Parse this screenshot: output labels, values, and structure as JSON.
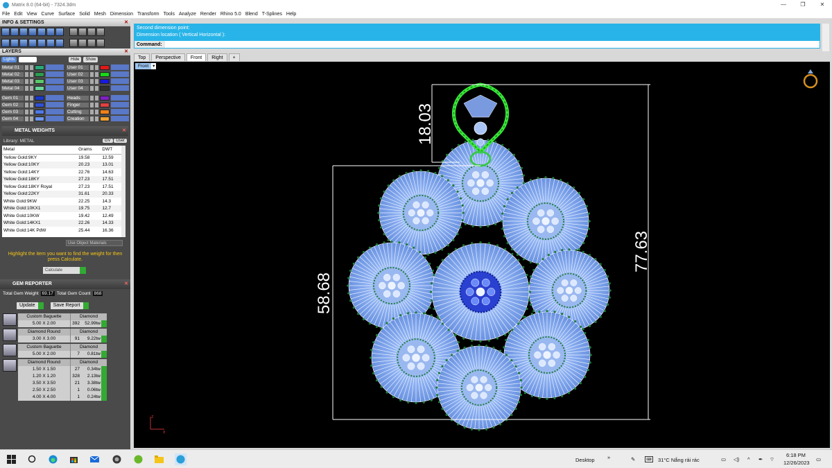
{
  "window": {
    "title": "Matrix 8.0 (64-bit) - 7324.3dm",
    "controls": [
      "—",
      "❐",
      "✕"
    ]
  },
  "menu": [
    "File",
    "Edit",
    "View",
    "Curve",
    "Surface",
    "Solid",
    "Mesh",
    "Dimension",
    "Transform",
    "Tools",
    "Analyze",
    "Render",
    "Rhino 5.0",
    "Blend",
    "T-Splines",
    "Help"
  ],
  "info_settings": {
    "title": "INFO & SETTINGS"
  },
  "layers": {
    "title": "LAYERS",
    "lights_label": "Lights",
    "hide_label": "Hide",
    "show_label": "Show",
    "group1_left": [
      {
        "name": "Metal 01",
        "color": "#2aa87a"
      },
      {
        "name": "Metal 02",
        "color": "#2c9a50"
      },
      {
        "name": "Metal 03",
        "color": "#58c86a"
      },
      {
        "name": "Metal 04",
        "color": "#6ad89a"
      }
    ],
    "group1_right": [
      {
        "name": "User 01",
        "color": "#e01818"
      },
      {
        "name": "User 02",
        "color": "#18d818"
      },
      {
        "name": "User 03",
        "color": "#1818e0"
      },
      {
        "name": "User 04",
        "color": "#303030"
      }
    ],
    "group2_left": [
      {
        "name": "Gem 01",
        "color": "#1838c8"
      },
      {
        "name": "Gem 02",
        "color": "#3050d8"
      },
      {
        "name": "Gem 03",
        "color": "#5078e8"
      },
      {
        "name": "Gem 04",
        "color": "#7098f0"
      }
    ],
    "group2_right": [
      {
        "name": "Heads",
        "color": "#8020c0"
      },
      {
        "name": "Finger",
        "color": "#e04040"
      },
      {
        "name": "Cutting",
        "color": "#f08018"
      },
      {
        "name": "Creation",
        "color": "#f0a030"
      }
    ]
  },
  "metal_weights": {
    "title": "METAL WEIGHTS",
    "library_label": "Library: METAL",
    "gv_label": "GV",
    "user_label": "User",
    "columns": [
      "Metal",
      "Grams",
      "DWT"
    ],
    "rows": [
      [
        "Yellow Gold:9KY",
        "19.58",
        "12.59"
      ],
      [
        "Yellow Gold:10KY",
        "20.23",
        "13.01"
      ],
      [
        "Yellow Gold:14KY",
        "22.76",
        "14.63"
      ],
      [
        "Yellow Gold:18KY",
        "27.23",
        "17.51"
      ],
      [
        "Yellow Gold:18KY Royal",
        "27.23",
        "17.51"
      ],
      [
        "Yellow Gold:22KY",
        "31.61",
        "20.33"
      ],
      [
        "White Gold:9KW",
        "22.25",
        "14.3"
      ],
      [
        "White Gold:10KX1",
        "19.75",
        "12.7"
      ],
      [
        "White Gold:10KW",
        "19.42",
        "12.49"
      ],
      [
        "White Gold:14KX1",
        "22.26",
        "14.33"
      ],
      [
        "White Gold:14K PdW",
        "25.44",
        "16.36"
      ]
    ],
    "use_object_materials": "Use Object Materials",
    "hint": "Highlight the item you want to find the weight for then press Calculate.",
    "calculate": "Calculate"
  },
  "gem_reporter": {
    "title": "GEM REPORTER",
    "total_weight_label": "Total Gem Weight",
    "total_weight": "69.17",
    "total_count_label": "Total Gem Count",
    "total_count": "868",
    "update": "Update",
    "save_report": "Save Report",
    "groups": [
      {
        "cut": "Custom Baguette",
        "type": "Diamond",
        "rows": [
          [
            "5.00 X 2.00",
            "392",
            "52.99tw"
          ]
        ]
      },
      {
        "cut": "Diamond Round",
        "type": "Diamond",
        "rows": [
          [
            "3.00 X 3.00",
            "91",
            "9.22tw"
          ]
        ]
      },
      {
        "cut": "Custom Baguette",
        "type": "Diamond",
        "rows": [
          [
            "5.00 X 2.00",
            "7",
            "0.81tw"
          ]
        ]
      },
      {
        "cut": "Diamond Round",
        "type": "Diamond",
        "rows": [
          [
            "1.50 X 1.50",
            "27",
            "0.34tw"
          ],
          [
            "1.20 X 1.20",
            "328",
            "2.13tw"
          ],
          [
            "3.50 X 3.50",
            "21",
            "3.38tw"
          ],
          [
            "2.50 X 2.50",
            "1",
            "0.06tw"
          ],
          [
            "4.00 X 4.00",
            "1",
            "0.24tw"
          ]
        ]
      }
    ]
  },
  "command": {
    "history_line1": "Second dimension point:",
    "history_line2": "Dimension location ( Vertical  Horizontal ):",
    "prompt": "Command:",
    "value": ""
  },
  "viewport_tabs": [
    "Top",
    "Perspective",
    "Front",
    "Right",
    "+"
  ],
  "active_viewport": "Front",
  "dimensions": {
    "top_height": "18.03",
    "total_height": "77.63",
    "body_height": "58.68"
  },
  "axis": {
    "z": "z",
    "x": "x"
  },
  "taskbar": {
    "desktop_label": "Desktop",
    "weather": "31°C  Nắng rải rác",
    "time": "6:18 PM",
    "date": "12/26/2023"
  }
}
